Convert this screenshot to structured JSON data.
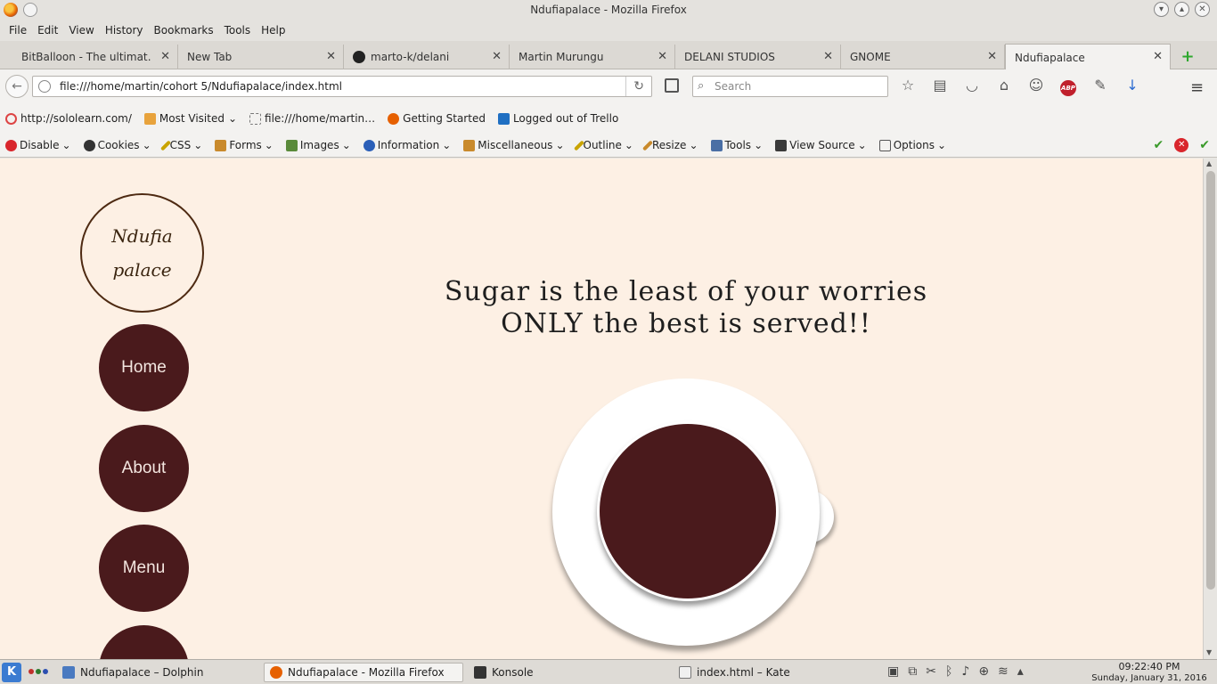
{
  "window": {
    "title": "Ndufiapalace - Mozilla Firefox"
  },
  "menubar": {
    "items": [
      "File",
      "Edit",
      "View",
      "History",
      "Bookmarks",
      "Tools",
      "Help"
    ]
  },
  "tabs": [
    {
      "label": "BitBalloon - The ultimat…",
      "close": "✕"
    },
    {
      "label": "New Tab",
      "close": "✕"
    },
    {
      "label": "marto-k/delani",
      "close": "✕"
    },
    {
      "label": "Martin Murungu",
      "close": "✕"
    },
    {
      "label": "DELANI STUDIOS",
      "close": "✕"
    },
    {
      "label": "GNOME",
      "close": "✕"
    },
    {
      "label": "Ndufiapalace",
      "close": "✕"
    }
  ],
  "navbar": {
    "url": "file:///home/martin/cohort 5/Ndufiapalace/index.html",
    "search_placeholder": "Search"
  },
  "bookmarks": [
    {
      "label": "http://sololearn.com/",
      "icon": "sololearn-icon"
    },
    {
      "label": "Most Visited",
      "icon": "folder-icon"
    },
    {
      "label": "file:///home/martin…",
      "icon": "file-icon"
    },
    {
      "label": "Getting Started",
      "icon": "firefox-icon"
    },
    {
      "label": "Logged out of Trello",
      "icon": "trello-icon"
    }
  ],
  "devtools": [
    {
      "label": "Disable",
      "icon": "disable-icon",
      "color": "#d9262c"
    },
    {
      "label": "Cookies",
      "icon": "cookies-icon",
      "color": "#333333"
    },
    {
      "label": "CSS",
      "icon": "css-icon",
      "color": "#c9a400"
    },
    {
      "label": "Forms",
      "icon": "forms-icon",
      "color": "#c98a2c"
    },
    {
      "label": "Images",
      "icon": "images-icon",
      "color": "#5a8a3a"
    },
    {
      "label": "Information",
      "icon": "information-icon",
      "color": "#2b5fb8"
    },
    {
      "label": "Miscellaneous",
      "icon": "miscellaneous-icon",
      "color": "#c98a2c"
    },
    {
      "label": "Outline",
      "icon": "outline-icon",
      "color": "#c9a400"
    },
    {
      "label": "Resize",
      "icon": "resize-icon",
      "color": "#c98a2c"
    },
    {
      "label": "Tools",
      "icon": "tools-icon",
      "color": "#4a6fa5"
    },
    {
      "label": "View Source",
      "icon": "view-source-icon",
      "color": "#3a3a3a"
    },
    {
      "label": "Options",
      "icon": "options-icon",
      "color": "#555555"
    }
  ],
  "page": {
    "logo_line1": "Ndufia",
    "logo_line2": "palace",
    "nav": [
      "Home",
      "About",
      "Menu"
    ],
    "headline_line1": "Sugar is the least of your worries",
    "headline_line2": "ONLY the best is served!!",
    "colors": {
      "background": "#fdf0e4",
      "accent": "#4a1a1c",
      "logo_border": "#4e2a12"
    }
  },
  "taskbar": {
    "tasks": [
      {
        "label": "Ndufiapalace – Dolphin",
        "icon": "dolphin-icon"
      },
      {
        "label": "Ndufiapalace - Mozilla Firefox",
        "icon": "firefox-icon"
      },
      {
        "label": "Konsole",
        "icon": "konsole-icon"
      },
      {
        "label": "index.html – Kate",
        "icon": "kate-icon"
      }
    ],
    "time": "09:22:40 PM",
    "date": "Sunday, January 31, 2016"
  }
}
